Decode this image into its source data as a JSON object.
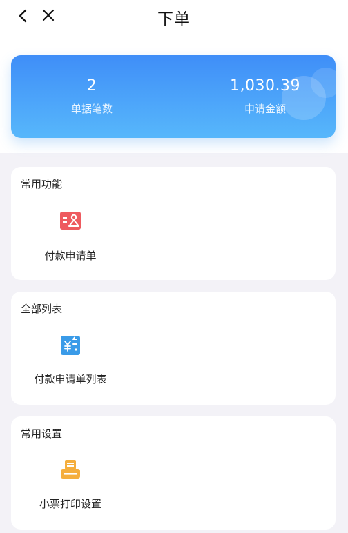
{
  "header": {
    "title": "下单"
  },
  "summary": {
    "doc_count": "2",
    "doc_count_label": "单据笔数",
    "amount": "1,030.39",
    "amount_label": "申请金额"
  },
  "sections": [
    {
      "title": "常用功能",
      "item": {
        "label": "付款申请单",
        "icon": "payment-request-icon",
        "color": "#ee5a5f"
      }
    },
    {
      "title": "全部列表",
      "item": {
        "label": "付款申请单列表",
        "icon": "payment-list-icon",
        "color": "#3a9be8"
      }
    },
    {
      "title": "常用设置",
      "item": {
        "label": "小票打印设置",
        "icon": "printer-icon",
        "color": "#f5ae3c"
      }
    }
  ],
  "colors": {
    "summary_top": "#3f8ef8",
    "summary_bottom": "#57b7fb"
  }
}
